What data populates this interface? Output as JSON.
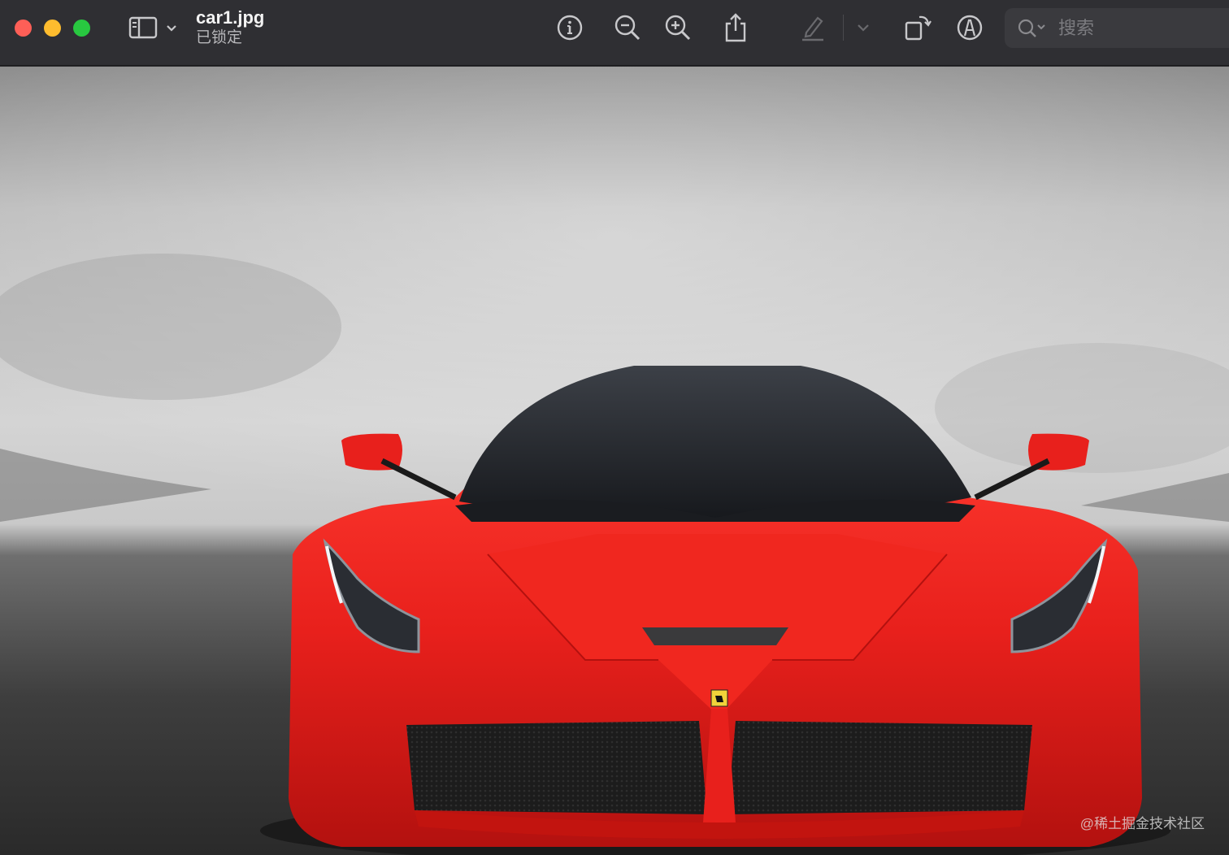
{
  "window": {
    "title": "car1.jpg",
    "subtitle": "已锁定"
  },
  "toolbar": {
    "sidebar_icon": "sidebar-icon",
    "info_icon": "info-icon",
    "zoom_out_icon": "zoom-out-icon",
    "zoom_in_icon": "zoom-in-icon",
    "share_icon": "share-icon",
    "highlight_icon": "highlight-icon",
    "rotate_icon": "rotate-icon",
    "markup_icon": "markup-icon"
  },
  "search": {
    "placeholder": "搜索"
  },
  "image": {
    "watermark": "@稀土掘金技术社区"
  },
  "colors": {
    "titlebar": "#2f2f33",
    "car_red": "#e8201c",
    "close": "#fe5f57",
    "minimize": "#febc2e",
    "zoom": "#28c840"
  }
}
